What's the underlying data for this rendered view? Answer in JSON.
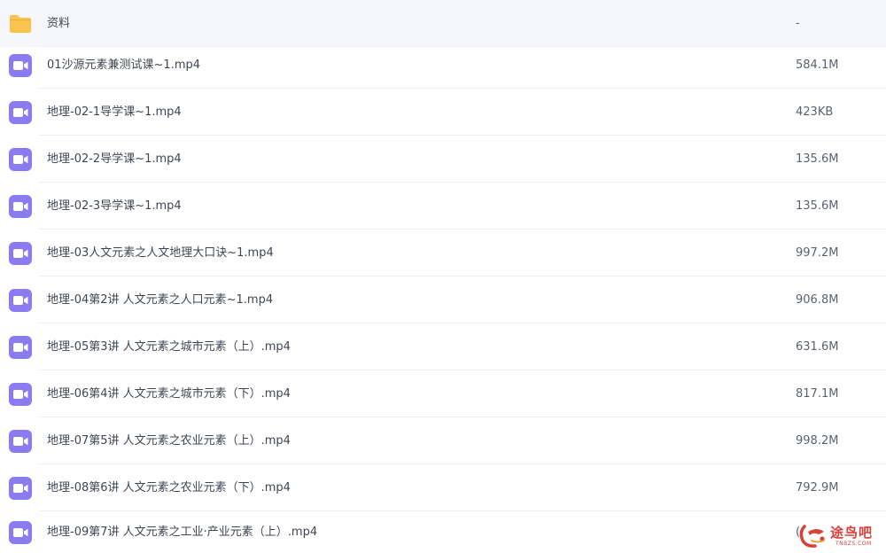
{
  "files": [
    {
      "name": "资料",
      "size": "-",
      "icon": "folder-icon"
    },
    {
      "name": "01沙源元素兼测试课~1.mp4",
      "size": "584.1M",
      "icon": "video-file-icon"
    },
    {
      "name": "地理-02-1导学课~1.mp4",
      "size": "423KB",
      "icon": "video-file-icon"
    },
    {
      "name": "地理-02-2导学课~1.mp4",
      "size": "135.6M",
      "icon": "video-file-icon"
    },
    {
      "name": "地理-02-3导学课~1.mp4",
      "size": "135.6M",
      "icon": "video-file-icon"
    },
    {
      "name": "地理-03人文元素之人文地理大口诀~1.mp4",
      "size": "997.2M",
      "icon": "video-file-icon"
    },
    {
      "name": "地理-04第2讲 人文元素之人口元素~1.mp4",
      "size": "906.8M",
      "icon": "video-file-icon"
    },
    {
      "name": "地理-05第3讲 人文元素之城市元素（上）.mp4",
      "size": "631.6M",
      "icon": "video-file-icon"
    },
    {
      "name": "地理-06第4讲 人文元素之城市元素（下）.mp4",
      "size": "817.1M",
      "icon": "video-file-icon"
    },
    {
      "name": "地理-07第5讲 人文元素之农业元素（上）.mp4",
      "size": "998.2M",
      "icon": "video-file-icon"
    },
    {
      "name": "地理-08第6讲 人文元素之农业元素（下）.mp4",
      "size": "792.9M",
      "icon": "video-file-icon"
    },
    {
      "name": "地理-09第7讲 人文元素之工业·产业元素（上）.mp4",
      "size": "(",
      "icon": "video-file-icon"
    }
  ],
  "watermark": {
    "text": "途鸟吧",
    "subtext": "TNBZS.COM"
  },
  "colors": {
    "folder": "#f9c34e",
    "folder_tab": "#f0b23a",
    "video": "#8a7cf0",
    "watermark": "#d8413a"
  }
}
